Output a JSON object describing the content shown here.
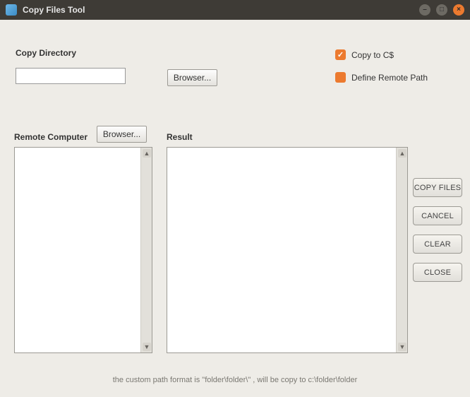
{
  "window": {
    "title": "Copy Files Tool"
  },
  "copy_directory": {
    "label": "Copy Directory",
    "value": "",
    "browse_label": "Browser..."
  },
  "remote_computer": {
    "label": "Remote Computer",
    "browse_label": "Browser..."
  },
  "result": {
    "label": "Result"
  },
  "options": {
    "copy_to_cs": {
      "label": "Copy to C$",
      "checked": true
    },
    "define_remote_path": {
      "label": "Define Remote Path",
      "checked": false
    }
  },
  "actions": {
    "copy_files": "COPY FILES",
    "cancel": "CANCEL",
    "clear": "CLEAR",
    "close": "CLOSE"
  },
  "footer": {
    "hint": "the custom path  format is \"folder\\folder\\\" , will be copy to c:\\folder\\folder"
  }
}
